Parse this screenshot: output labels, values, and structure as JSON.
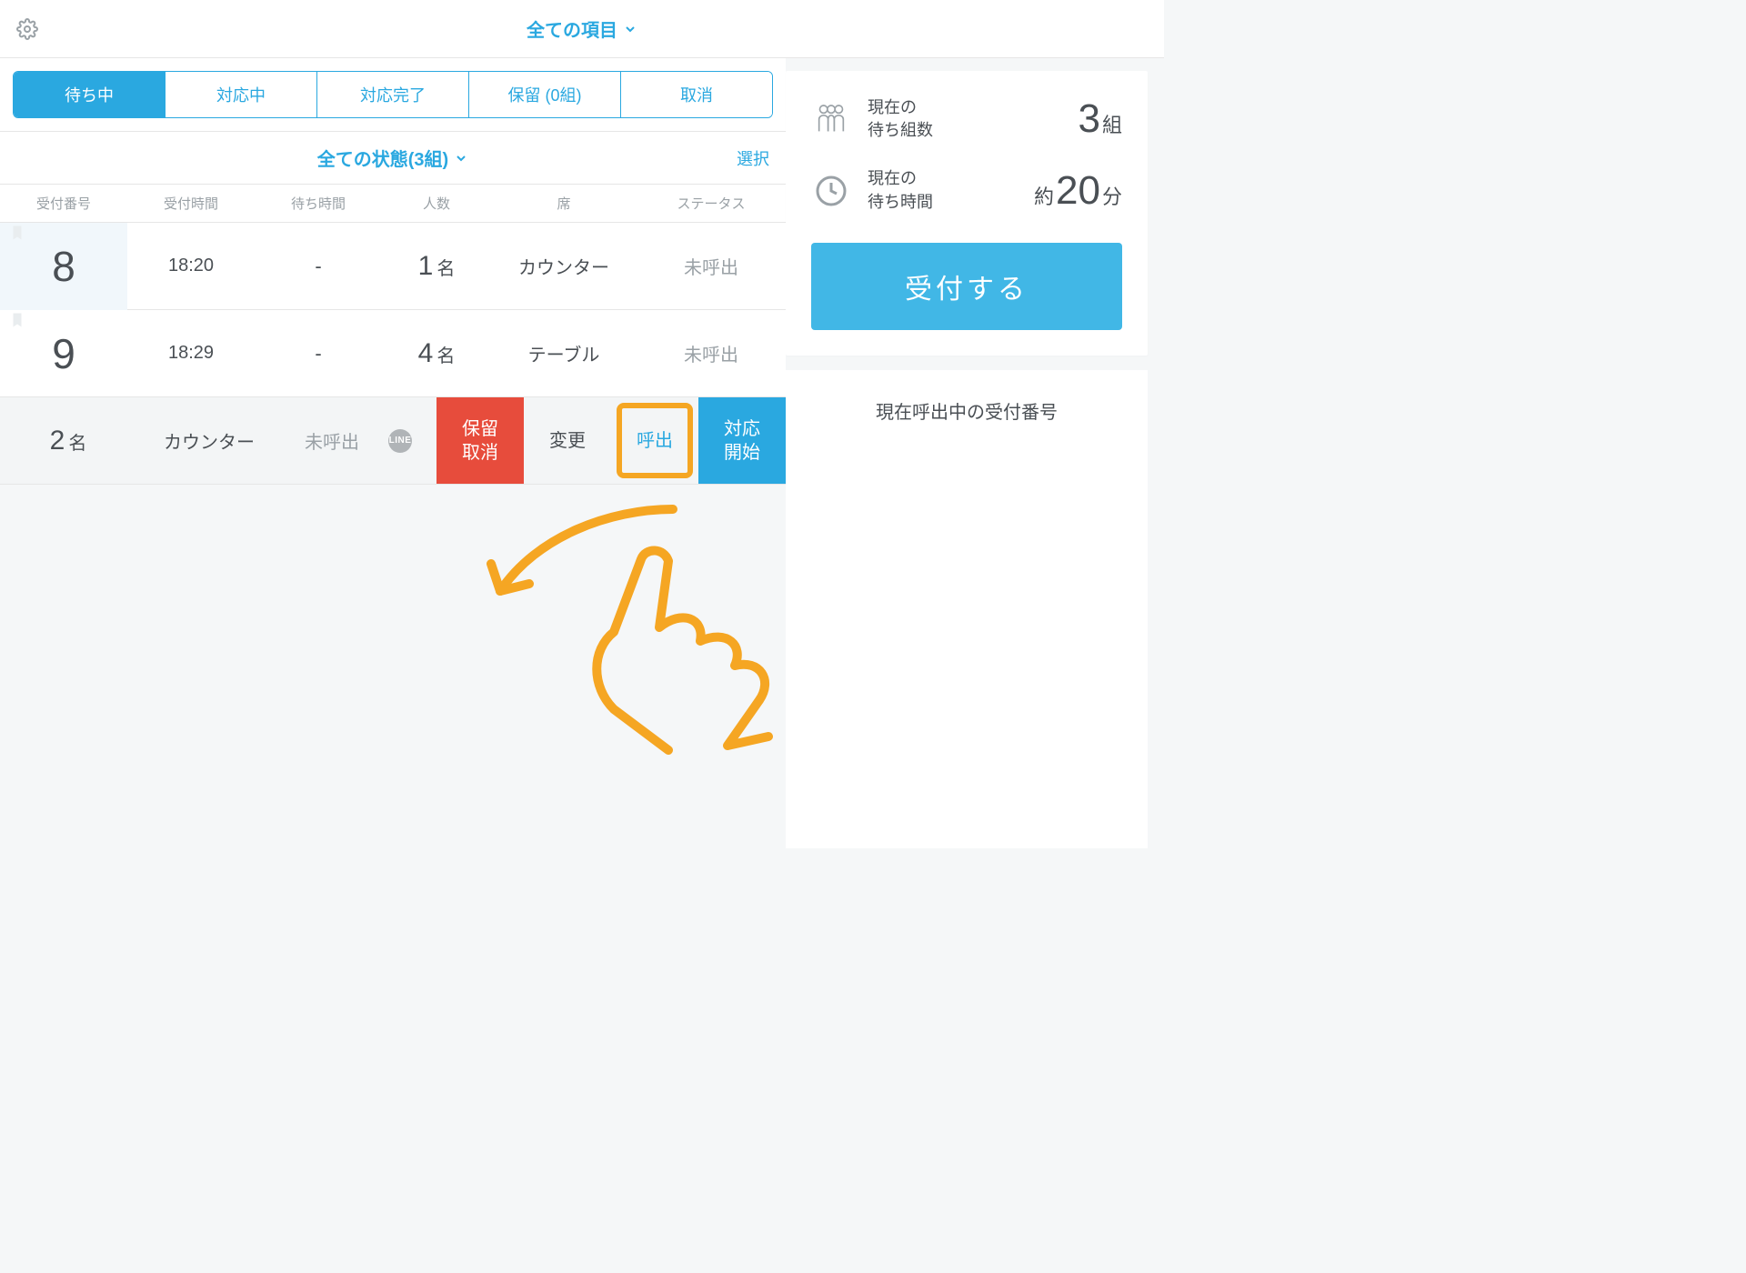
{
  "header": {
    "title": "全ての項目"
  },
  "tabs": [
    {
      "label": "待ち中",
      "active": true
    },
    {
      "label": "対応中"
    },
    {
      "label": "対応完了"
    },
    {
      "label": "保留 (0組)"
    },
    {
      "label": "取消"
    }
  ],
  "filter": {
    "label": "全ての状態(3組)",
    "select": "選択"
  },
  "columns": {
    "num": "受付番号",
    "time": "受付時間",
    "wait": "待ち時間",
    "party": "人数",
    "seat": "席",
    "status": "ステータス"
  },
  "rows": [
    {
      "num": "8",
      "time": "18:20",
      "wait": "-",
      "party_num": "1",
      "party_suffix": "名",
      "seat": "カウンター",
      "status": "未呼出",
      "highlight": true
    },
    {
      "num": "9",
      "time": "18:29",
      "wait": "-",
      "party_num": "4",
      "party_suffix": "名",
      "seat": "テーブル",
      "status": "未呼出"
    }
  ],
  "action_row": {
    "party_num": "2",
    "party_suffix": "名",
    "seat": "カウンター",
    "status": "未呼出",
    "line_badge": "LINE",
    "buttons": {
      "hold_cancel": "保留\n取消",
      "change": "変更",
      "call": "呼出",
      "start": "対応\n開始"
    }
  },
  "right": {
    "wait_groups_label": "現在の\n待ち組数",
    "wait_groups_value": "3",
    "wait_groups_suffix": "組",
    "wait_time_label": "現在の\n待ち時間",
    "wait_time_prefix": "約",
    "wait_time_value": "20",
    "wait_time_suffix": "分",
    "primary_button": "受付する",
    "calling_title": "現在呼出中の受付番号"
  }
}
